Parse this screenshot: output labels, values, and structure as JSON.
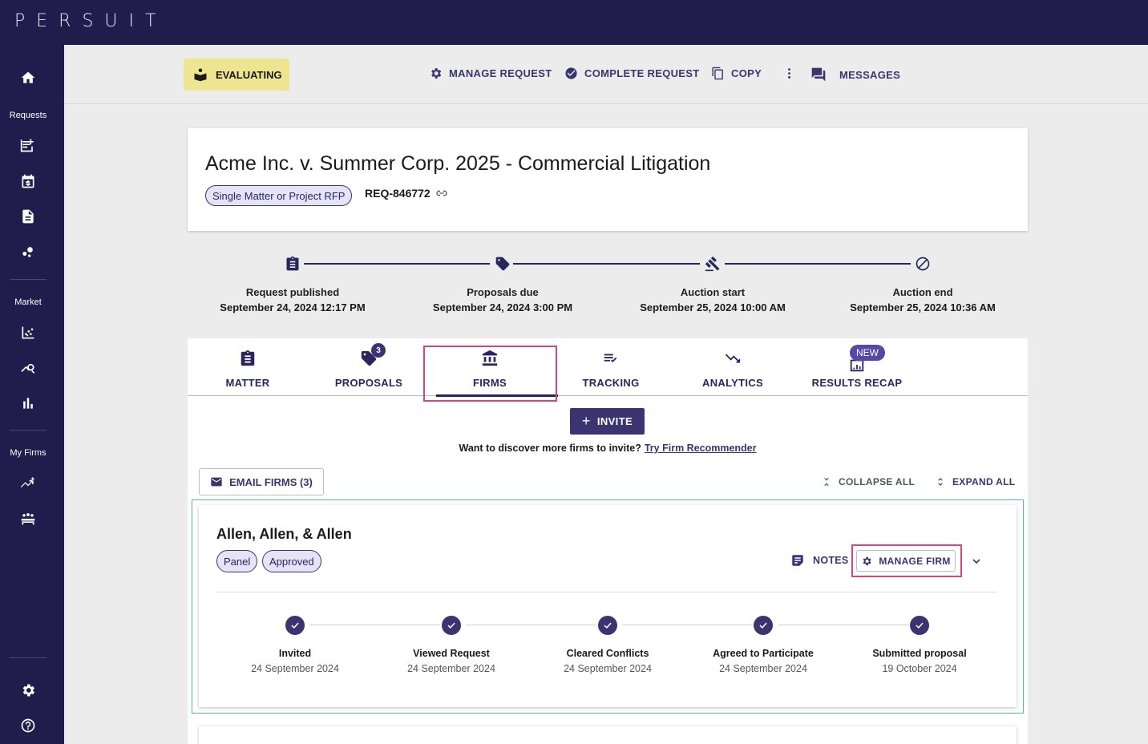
{
  "app": {
    "logo": "PERSUIT"
  },
  "sidebar": {
    "sections": [
      "Requests",
      "Market",
      "My Firms"
    ]
  },
  "actionbar": {
    "status": "EVALUATING",
    "manage_request": "MANAGE REQUEST",
    "complete_request": "COMPLETE REQUEST",
    "copy": "COPY",
    "messages": "MESSAGES"
  },
  "request": {
    "title": "Acme Inc. v. Summer Corp. 2025 - Commercial Litigation",
    "type": "Single Matter or Project RFP",
    "id": "REQ-846772"
  },
  "timeline": [
    {
      "label": "Request published",
      "date": "September 24, 2024 12:17 PM"
    },
    {
      "label": "Proposals due",
      "date": "September 24, 2024 3:00 PM"
    },
    {
      "label": "Auction start",
      "date": "September 25, 2024 10:00 AM"
    },
    {
      "label": "Auction end",
      "date": "September 25, 2024 10:36 AM"
    }
  ],
  "tabs": [
    {
      "label": "MATTER"
    },
    {
      "label": "PROPOSALS",
      "badge": "3"
    },
    {
      "label": "FIRMS",
      "active": true
    },
    {
      "label": "TRACKING"
    },
    {
      "label": "ANALYTICS"
    },
    {
      "label": "RESULTS RECAP",
      "new_badge": "NEW"
    }
  ],
  "firms_tab": {
    "invite": "INVITE",
    "discover_text": "Want to discover more firms to invite?",
    "discover_link": "Try Firm Recommender",
    "email_firms": "EMAIL FIRMS (3)",
    "collapse_all": "COLLAPSE ALL",
    "expand_all": "EXPAND ALL"
  },
  "firm": {
    "name": "Allen, Allen, & Allen",
    "tags": [
      "Panel",
      "Approved"
    ],
    "notes": "NOTES",
    "manage_firm": "MANAGE FIRM",
    "steps": [
      {
        "label": "Invited",
        "date": "24 September 2024"
      },
      {
        "label": "Viewed Request",
        "date": "24 September 2024"
      },
      {
        "label": "Cleared Conflicts",
        "date": "24 September 2024"
      },
      {
        "label": "Agreed to Participate",
        "date": "24 September 2024"
      },
      {
        "label": "Submitted proposal",
        "date": "19 October 2024"
      }
    ]
  },
  "colors": {
    "navy": "#201c4b",
    "primary": "#3b3470",
    "status_chip": "#ede58f",
    "highlight": "#d6457c",
    "outline": "#4fc0b0"
  }
}
